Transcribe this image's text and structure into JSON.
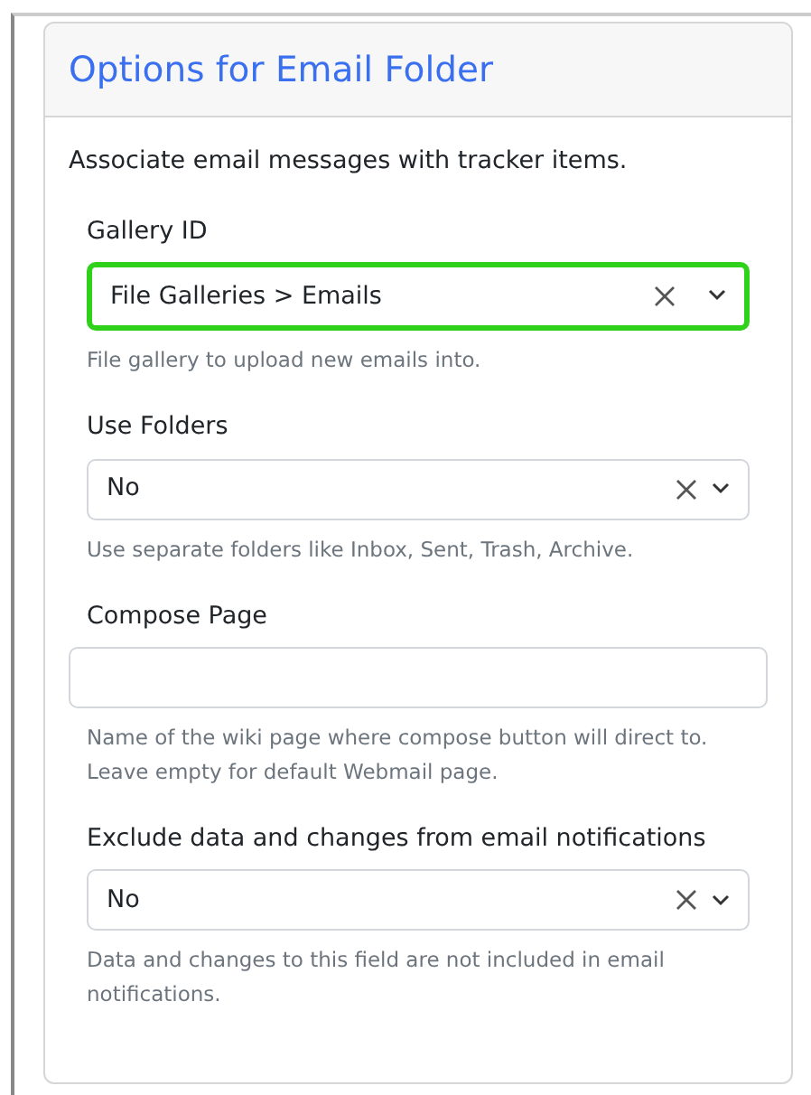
{
  "panel": {
    "title": "Options for Email Folder",
    "description": "Associate email messages with tracker items."
  },
  "fields": [
    {
      "kind": "select",
      "label": "Gallery ID",
      "value": "File Galleries > Emails",
      "focused": true,
      "help": "File gallery to upload new emails into."
    },
    {
      "kind": "select",
      "label": "Use Folders",
      "value": "No",
      "focused": false,
      "help": "Use separate folders like Inbox, Sent, Trash, Archive."
    },
    {
      "kind": "text",
      "label": "Compose Page",
      "focused": false,
      "help": "Name of the wiki page where compose button will direct to. Leave empty for default Webmail page."
    },
    {
      "kind": "select",
      "label": "Exclude data and changes from email notifications",
      "value": "No",
      "focused": false,
      "help": "Data and changes to this field are not included in email notifications."
    }
  ]
}
